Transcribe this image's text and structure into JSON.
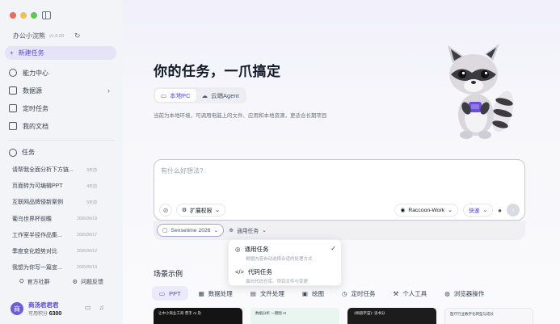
{
  "window": {
    "traffic_colors": [
      "#ee6a5f",
      "#f5be4f",
      "#62c554"
    ]
  },
  "sidebar": {
    "brand": "办公小浣熊",
    "version": "v1.0.20",
    "new_task": "新建任务",
    "items": [
      {
        "label": "能力中心",
        "icon": "lightbulb-icon"
      },
      {
        "label": "数据源",
        "icon": "database-icon"
      },
      {
        "label": "定时任务",
        "icon": "calendar-icon"
      },
      {
        "label": "我的文档",
        "icon": "document-icon"
      }
    ],
    "tasks_heading": "任务",
    "tasks": [
      {
        "title": "请帮我全面分析下方链...",
        "date": "3天前"
      },
      {
        "title": "页面转为可编辑PPT",
        "date": "4天前"
      },
      {
        "title": "互联网品牌侵新案例",
        "date": "5天前"
      },
      {
        "title": "葡乌世界杯前瞻",
        "date": "2026/06/18"
      },
      {
        "title": "工作室半径作品集...",
        "date": "2026/06/17"
      },
      {
        "title": "季度变化趋势对比",
        "date": "2026/06/12"
      },
      {
        "title": "我想为你写一篇宣...",
        "date": "2026/05/13"
      }
    ],
    "links": [
      "官方社群",
      "问题反馈"
    ],
    "user": {
      "avatar_letter": "商",
      "name": "商汤君君君",
      "credits_label": "可用积分",
      "credits": "6300"
    }
  },
  "main": {
    "title": "你的任务，一爪搞定",
    "modes": [
      {
        "label": "本地PC",
        "active": true
      },
      {
        "label": "云端Agent",
        "active": false
      }
    ],
    "hint": "当前为本地环境，可调用电脑上的文件、应用和本地资源，更适合长期项目",
    "input": {
      "placeholder": "有什么好想法?",
      "expand_label": "扩展权限",
      "agent_label": "Raccoon-Work",
      "speed_label": "快速"
    },
    "toolbar": {
      "model": "Sensetime 2026",
      "task_type": "通用任务"
    },
    "dropdown": [
      {
        "title": "通用任务",
        "desc": "根据内容自动选择合适的处理方式",
        "checked": true
      },
      {
        "title": "代码任务",
        "desc": "面向代码仓库、项目文件与变更",
        "checked": false
      }
    ],
    "scene_title": "场景示例",
    "categories": [
      {
        "label": "PPT",
        "active": true
      },
      {
        "label": "数据处理",
        "active": false
      },
      {
        "label": "文件处理",
        "active": false
      },
      {
        "label": "绘图",
        "active": false
      },
      {
        "label": "定时任务",
        "active": false
      },
      {
        "label": "个人工具",
        "active": false
      },
      {
        "label": "浏览器操作",
        "active": false
      }
    ],
    "thumbs": [
      "让中小商业工商 营丰 AI 及",
      "数据分析 一键图 AI",
      "《绚丽宇宙》读书分",
      "医疗行业数字化转型与成长"
    ]
  }
}
